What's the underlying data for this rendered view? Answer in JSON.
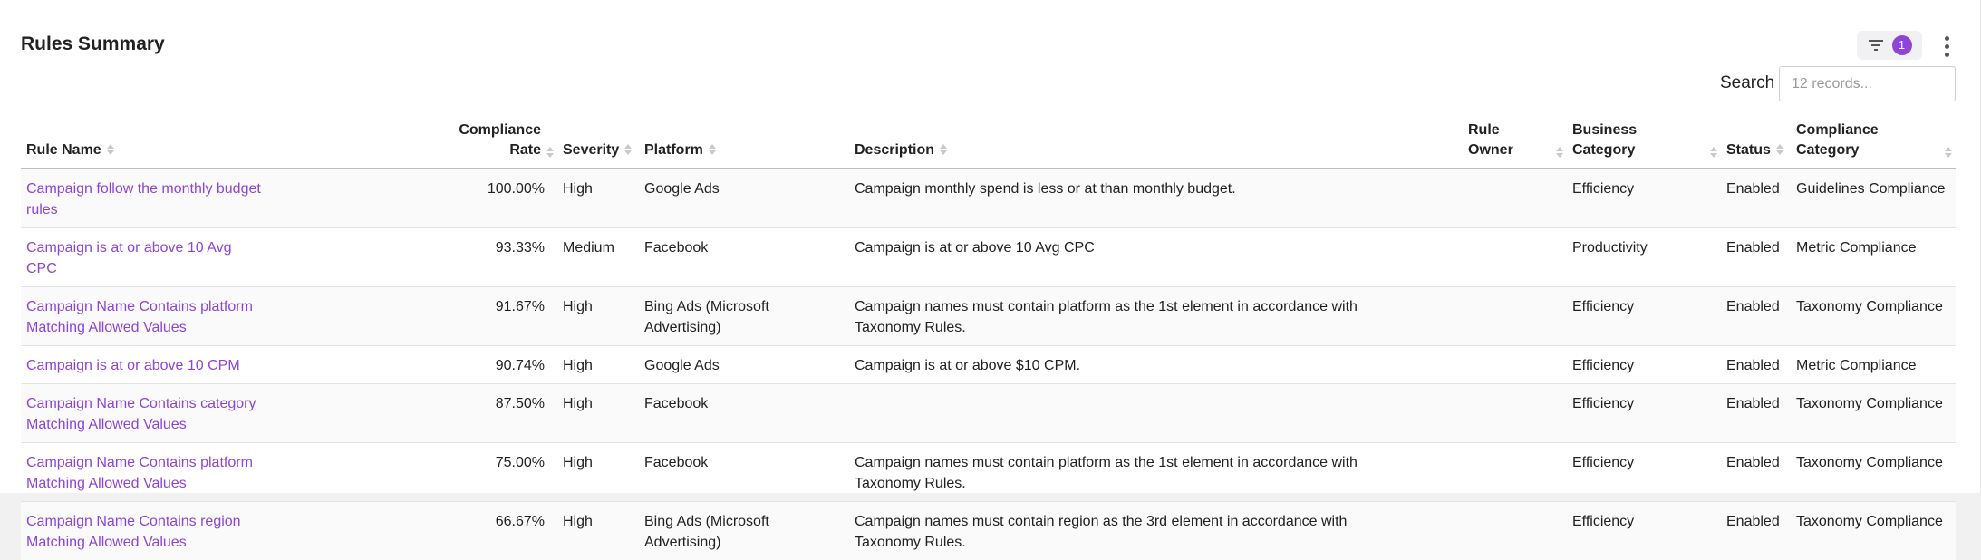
{
  "header": {
    "title": "Rules Summary",
    "filter_count": "1",
    "search_label": "Search",
    "search_placeholder": "12 records..."
  },
  "colors": {
    "accent": "#8e44d8",
    "link": "#8e44d8"
  },
  "icons": {
    "filter": "filter-icon",
    "menu": "more-vertical-icon",
    "sort": "sort-arrows-icon"
  },
  "table": {
    "columns": [
      {
        "key": "rule_name",
        "label": "Rule Name"
      },
      {
        "key": "compliance_rate",
        "label": "Compliance Rate"
      },
      {
        "key": "severity",
        "label": "Severity"
      },
      {
        "key": "platform",
        "label": "Platform"
      },
      {
        "key": "description",
        "label": "Description"
      },
      {
        "key": "rule_owner",
        "label": "Rule Owner"
      },
      {
        "key": "business_category",
        "label": "Business Category"
      },
      {
        "key": "status",
        "label": "Status"
      },
      {
        "key": "compliance_category",
        "label": "Compliance Category"
      }
    ],
    "rows": [
      {
        "rule_name": "Campaign follow the monthly budget rules",
        "compliance_rate": "100.00%",
        "severity": "High",
        "platform": "Google Ads",
        "description": "Campaign monthly spend is less or at than monthly budget.",
        "rule_owner": "",
        "business_category": "Efficiency",
        "status": "Enabled",
        "compliance_category": "Guidelines Compliance"
      },
      {
        "rule_name": "Campaign is at or above 10 Avg CPC",
        "compliance_rate": "93.33%",
        "severity": "Medium",
        "platform": "Facebook",
        "description": "Campaign is at or above 10 Avg CPC",
        "rule_owner": "",
        "business_category": "Productivity",
        "status": "Enabled",
        "compliance_category": "Metric Compliance"
      },
      {
        "rule_name": "Campaign Name Contains platform Matching Allowed Values",
        "compliance_rate": "91.67%",
        "severity": "High",
        "platform": "Bing Ads (Microsoft Advertising)",
        "description": "Campaign names must contain platform as the 1st element in accordance with Taxonomy Rules.",
        "rule_owner": "",
        "business_category": "Efficiency",
        "status": "Enabled",
        "compliance_category": "Taxonomy Compliance"
      },
      {
        "rule_name": "Campaign is at or above 10 CPM",
        "compliance_rate": "90.74%",
        "severity": "High",
        "platform": "Google Ads",
        "description": "Campaign is at or above $10 CPM.",
        "rule_owner": "",
        "business_category": "Efficiency",
        "status": "Enabled",
        "compliance_category": "Metric Compliance"
      },
      {
        "rule_name": "Campaign Name Contains category Matching Allowed Values",
        "compliance_rate": "87.50%",
        "severity": "High",
        "platform": "Facebook",
        "description": "",
        "rule_owner": "",
        "business_category": "Efficiency",
        "status": "Enabled",
        "compliance_category": "Taxonomy Compliance"
      },
      {
        "rule_name": "Campaign Name Contains platform Matching Allowed Values",
        "compliance_rate": "75.00%",
        "severity": "High",
        "platform": "Facebook",
        "description": "Campaign names must contain platform as the 1st element in accordance with Taxonomy Rules.",
        "rule_owner": "",
        "business_category": "Efficiency",
        "status": "Enabled",
        "compliance_category": "Taxonomy Compliance"
      },
      {
        "rule_name": "Campaign Name Contains region Matching Allowed Values",
        "compliance_rate": "66.67%",
        "severity": "High",
        "platform": "Bing Ads (Microsoft Advertising)",
        "description": "Campaign names must contain region as the 3rd element in accordance with Taxonomy Rules.",
        "rule_owner": "",
        "business_category": "Efficiency",
        "status": "Enabled",
        "compliance_category": "Taxonomy Compliance"
      }
    ]
  }
}
